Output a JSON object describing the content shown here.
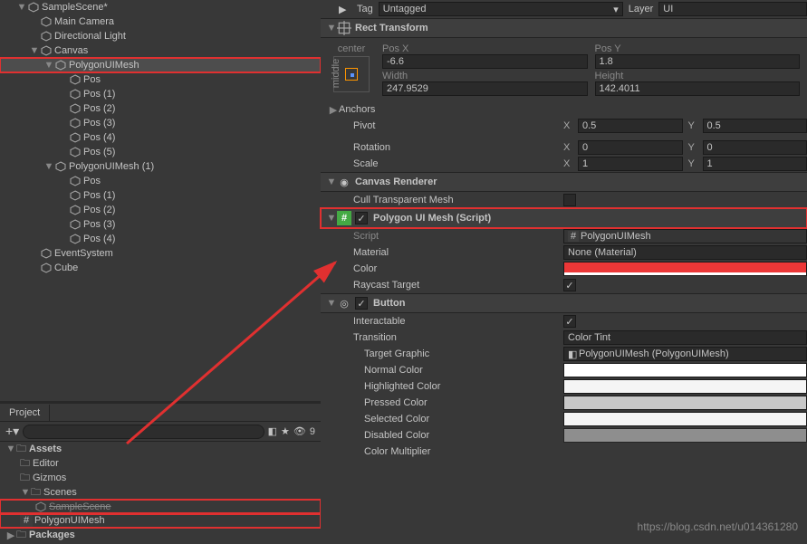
{
  "hierarchy": {
    "scene": "SampleScene*",
    "items": [
      "Main Camera",
      "Directional Light",
      "Canvas",
      "PolygonUIMesh",
      "Pos",
      "Pos (1)",
      "Pos (2)",
      "Pos (3)",
      "Pos (4)",
      "Pos (5)",
      "PolygonUIMesh (1)",
      "Pos",
      "Pos (1)",
      "Pos (2)",
      "Pos (3)",
      "Pos (4)",
      "EventSystem",
      "Cube"
    ]
  },
  "project": {
    "tab": "Project",
    "visibility_count": "9",
    "assets": "Assets",
    "folders": [
      "Editor",
      "Gizmos",
      "Scenes"
    ],
    "scene_file": "SampleScene",
    "script": "PolygonUIMesh",
    "packages": "Packages"
  },
  "inspector": {
    "tag_label": "Tag",
    "tag_value": "Untagged",
    "layer_label": "Layer",
    "layer_value": "UI",
    "rect": {
      "title": "Rect Transform",
      "anchor_h": "center",
      "anchor_v": "middle",
      "posx_l": "Pos X",
      "posx": "-6.6",
      "posy_l": "Pos Y",
      "posy": "1.8",
      "width_l": "Width",
      "width": "247.9529",
      "height_l": "Height",
      "height": "142.4011",
      "anchors": "Anchors",
      "pivot": "Pivot",
      "pivot_x": "0.5",
      "pivot_y": "0.5",
      "rotation": "Rotation",
      "rot_x": "0",
      "rot_y": "0",
      "scale": "Scale",
      "scale_x": "1",
      "scale_y": "1"
    },
    "canvas": {
      "title": "Canvas Renderer",
      "cull": "Cull Transparent Mesh"
    },
    "polymesh": {
      "title": "Polygon UI Mesh (Script)",
      "enabled": "✓",
      "script_l": "Script",
      "script": "PolygonUIMesh",
      "material_l": "Material",
      "material": "None (Material)",
      "color_l": "Color",
      "raycast_l": "Raycast Target",
      "raycast": "✓"
    },
    "button": {
      "title": "Button",
      "enabled": "✓",
      "interactable_l": "Interactable",
      "interactable": "✓",
      "transition_l": "Transition",
      "transition": "Color Tint",
      "target_l": "Target Graphic",
      "target": "PolygonUIMesh (PolygonUIMesh)",
      "normal_l": "Normal Color",
      "highlight_l": "Highlighted Color",
      "pressed_l": "Pressed Color",
      "selected_l": "Selected Color",
      "disabled_l": "Disabled Color",
      "multiplier_l": "Color Multiplier"
    }
  },
  "watermark": "https://blog.csdn.net/u014361280"
}
